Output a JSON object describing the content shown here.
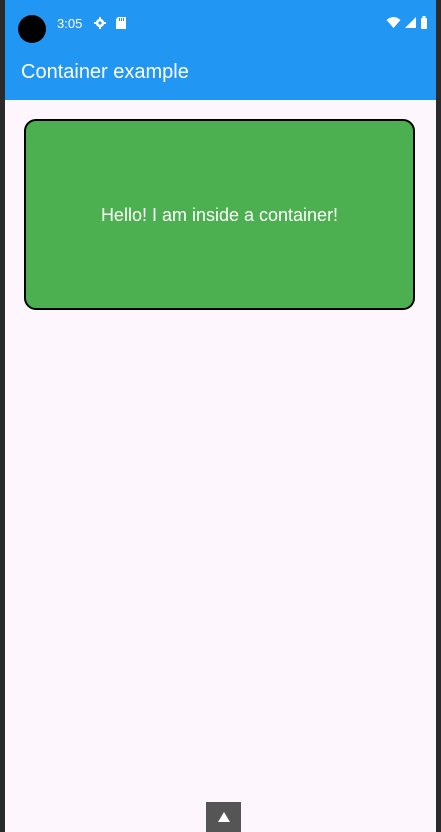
{
  "status_bar": {
    "time": "3:05",
    "icons": [
      "gear-icon",
      "sd-card-icon",
      "wifi-icon",
      "cell-signal-icon",
      "battery-icon"
    ]
  },
  "app_bar": {
    "title": "Container example",
    "background": "#2196f3"
  },
  "container": {
    "text": "Hello! I am inside a container!",
    "background": "#4caf50",
    "border_color": "#000000"
  },
  "nav": {
    "handle_icon": "up-triangle-icon"
  },
  "colors": {
    "page_background": "#fdf6fc"
  }
}
